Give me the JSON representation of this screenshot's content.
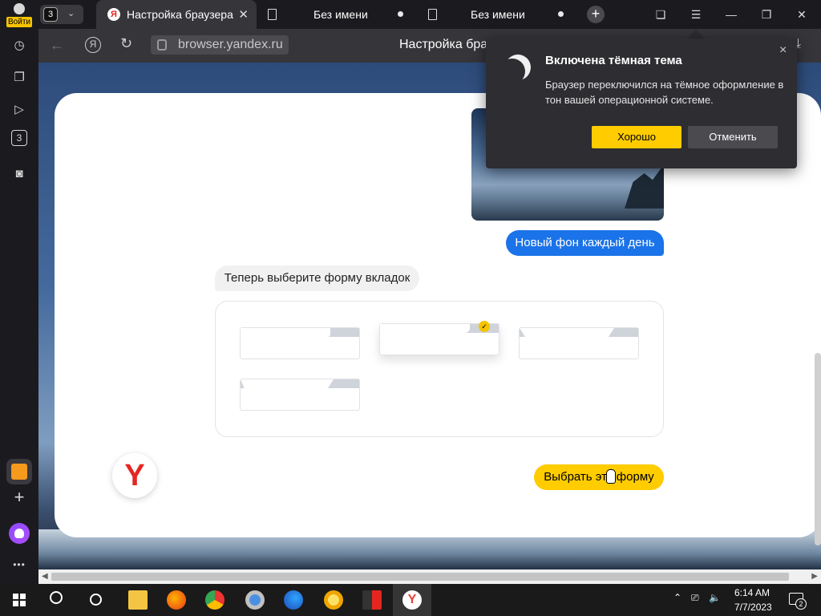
{
  "sidebar": {
    "login_label": "Войти",
    "items": [
      {
        "icon": "history-icon",
        "glyph": "◷"
      },
      {
        "icon": "collections-icon",
        "glyph": "❐"
      },
      {
        "icon": "video-icon",
        "glyph": "▷"
      },
      {
        "icon": "tab-count-icon",
        "glyph": "3"
      },
      {
        "icon": "screenshot-icon",
        "glyph": "◙"
      }
    ],
    "bottom_add": "+",
    "bottom_more": "•••"
  },
  "tabbar": {
    "tab_count": "3",
    "tabs": [
      {
        "title": "Настройка браузера",
        "active": true
      },
      {
        "title": "Без имени",
        "active": false
      },
      {
        "title": "Без имени",
        "active": false
      }
    ],
    "new_tab": "+"
  },
  "addressbar": {
    "url": "browser.yandex.ru",
    "page_title": "Настройка браз"
  },
  "page": {
    "new_bg_bubble": "Новый фон каждый день",
    "choose_prompt": "Теперь выберите форму вкладок",
    "choose_button": "Выбрать эту форму",
    "selected_shape_index": 1
  },
  "popup": {
    "title": "Включена тёмная тема",
    "text": "Браузер переключился на тёмное оформление в тон вашей операционной системе.",
    "ok": "Хорошо",
    "cancel": "Отменить",
    "close": "×"
  },
  "taskbar": {
    "time": "6:14 AM",
    "date": "7/7/2023",
    "notifications": "2"
  },
  "colors": {
    "accent_yellow": "#ffcc00",
    "bubble_blue": "#1a73e8",
    "yandex_red": "#e52620"
  }
}
